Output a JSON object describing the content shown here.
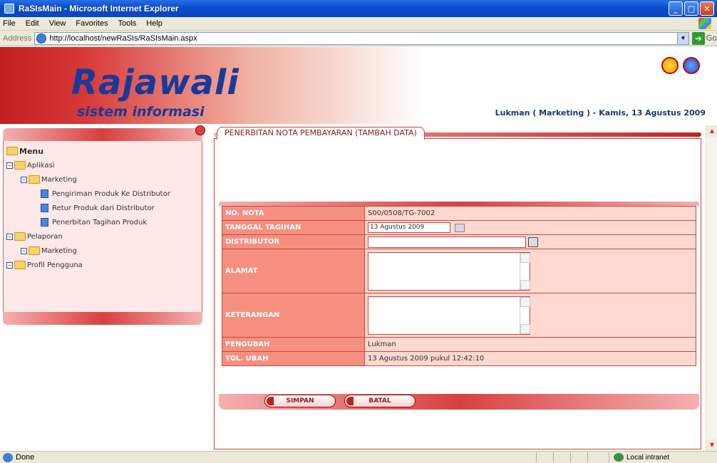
{
  "window": {
    "title": "RaSIsMain - Microsoft Internet Explorer",
    "controls": [
      "_",
      "□",
      "✕"
    ]
  },
  "menubar": [
    "File",
    "Edit",
    "View",
    "Favorites",
    "Tools",
    "Help"
  ],
  "address": {
    "label": "Address",
    "url": "http://localhost/newRaSIs/RaSIsMain.aspx",
    "go": "Go"
  },
  "banner": {
    "logo_main": "Rajawali",
    "logo_sub": "sistem informasi",
    "user_info": "Lukman ( Marketing ) - Kamis, 13 Agustus 2009"
  },
  "tree": {
    "root": "Menu",
    "items": [
      {
        "label": "Aplikasi",
        "level": 1,
        "kind": "folder"
      },
      {
        "label": "Marketing",
        "level": 2,
        "kind": "folder"
      },
      {
        "label": "Pengiriman Produk Ke Distributor",
        "level": 3,
        "kind": "doc"
      },
      {
        "label": "Retur Produk dari Distributor",
        "level": 3,
        "kind": "doc"
      },
      {
        "label": "Penerbitan Tagihan Produk",
        "level": 3,
        "kind": "doc"
      },
      {
        "label": "Pelaporan",
        "level": 1,
        "kind": "folder"
      },
      {
        "label": "Marketing",
        "level": 2,
        "kind": "folder"
      },
      {
        "label": "Profil Pengguna",
        "level": 1,
        "kind": "folder"
      }
    ]
  },
  "form": {
    "heading": "PENERBITAN NOTA PEMBAYARAN  (TAMBAH DATA)",
    "fields": {
      "no_nota": {
        "label": "NO. NOTA",
        "value": "S00/0508/TG-7002"
      },
      "tanggal": {
        "label": "TANGGAL TAGIHAN",
        "value": "13 Agustus 2009"
      },
      "distributor": {
        "label": "DISTRIBUTOR",
        "value": ""
      },
      "alamat": {
        "label": "ALAMAT",
        "value": ""
      },
      "keterangan": {
        "label": "KETERANGAN",
        "value": ""
      },
      "pengubah": {
        "label": "PENGUBAH",
        "value": "Lukman"
      },
      "tgl_ubah": {
        "label": "TGL. UBAH",
        "value": "13 Agustus 2009 pukul 12:42:10"
      }
    },
    "buttons": {
      "save": "SIMPAN",
      "cancel": "BATAL"
    }
  },
  "status": {
    "text": "Done",
    "zone": "Local intranet"
  }
}
